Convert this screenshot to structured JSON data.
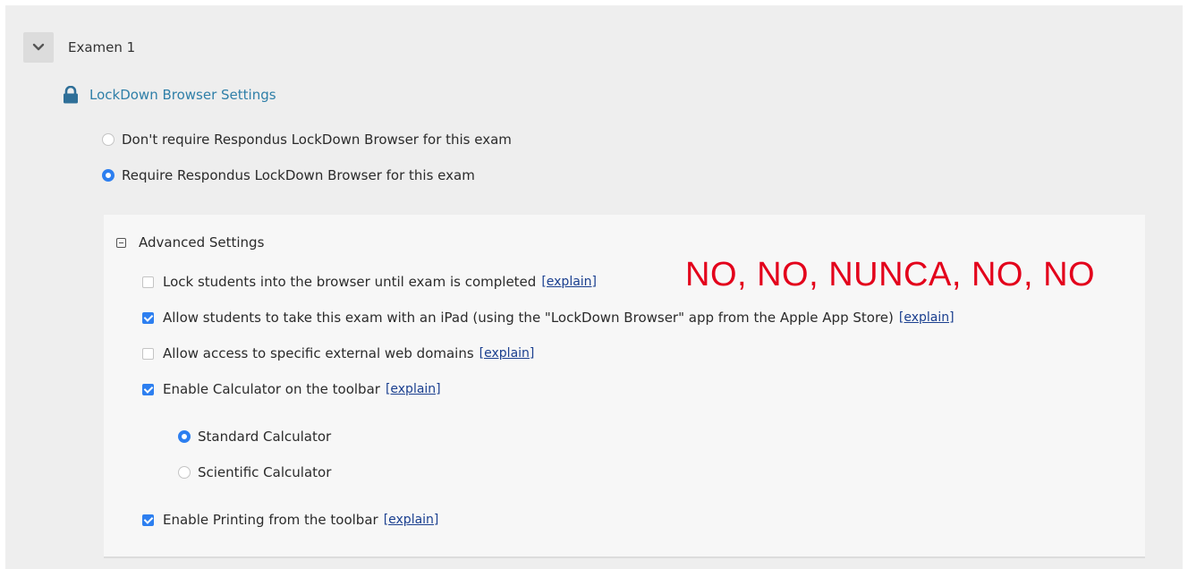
{
  "exam": {
    "title": "Examen 1"
  },
  "lockdown": {
    "title": "LockDown Browser Settings"
  },
  "require_options": [
    {
      "label": "Don't require Respondus LockDown Browser for this exam",
      "selected": false
    },
    {
      "label": "Require Respondus LockDown Browser for this exam",
      "selected": true
    }
  ],
  "advanced": {
    "title": "Advanced Settings",
    "options": [
      {
        "label": "Lock students into the browser until exam is completed",
        "checked": false,
        "link": "[explain]"
      },
      {
        "label": "Allow students to take this exam with an iPad (using the \"LockDown Browser\" app from the Apple App Store)",
        "checked": true,
        "link": "[explain]"
      },
      {
        "label": "Allow access to specific external web domains",
        "checked": false,
        "link": "[explain]"
      },
      {
        "label": "Enable Calculator on the toolbar",
        "checked": true,
        "link": "[explain]"
      },
      {
        "label": "Enable Printing from the toolbar",
        "checked": true,
        "link": "[explain]"
      }
    ],
    "calculator_options": [
      {
        "label": "Standard Calculator",
        "selected": true
      },
      {
        "label": "Scientific Calculator",
        "selected": false
      }
    ]
  },
  "annotation": "NO, NO, NUNCA, NO, NO",
  "colors": {
    "accent": "#2d7ff0",
    "link": "#2f7fa8",
    "annotation": "#e3001b"
  },
  "icons": [
    "chevron-down-icon",
    "lock-icon",
    "collapse-icon"
  ]
}
